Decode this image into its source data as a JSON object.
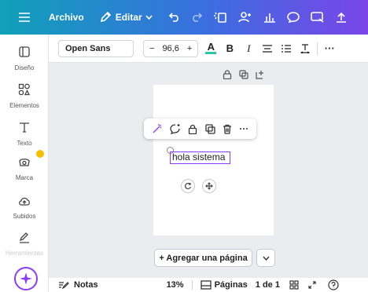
{
  "topbar": {
    "menu_archivo": "Archivo",
    "menu_editar": "Editar"
  },
  "sidebar": {
    "items": [
      {
        "label": "Diseño"
      },
      {
        "label": "Elementos"
      },
      {
        "label": "Texto"
      },
      {
        "label": "Marca"
      },
      {
        "label": "Subidos"
      },
      {
        "label": "Herramientas"
      }
    ]
  },
  "toolbar": {
    "font": "Open Sans",
    "minus": "−",
    "font_size": "96,6",
    "plus": "+",
    "text_color_letter": "A",
    "bold": "B",
    "italic": "I",
    "more": "···"
  },
  "canvas": {
    "text_value": "hola sistema",
    "context_more": "···"
  },
  "add_page": {
    "label": "+ Agregar una página"
  },
  "bottombar": {
    "notes": "Notas",
    "zoom": "13%",
    "pages": "Páginas",
    "page_count": "1 de 1"
  },
  "colors": {
    "accent": "#8b3dff",
    "text_color_bar": "#2ec4a8",
    "badge": "#f5c000"
  }
}
